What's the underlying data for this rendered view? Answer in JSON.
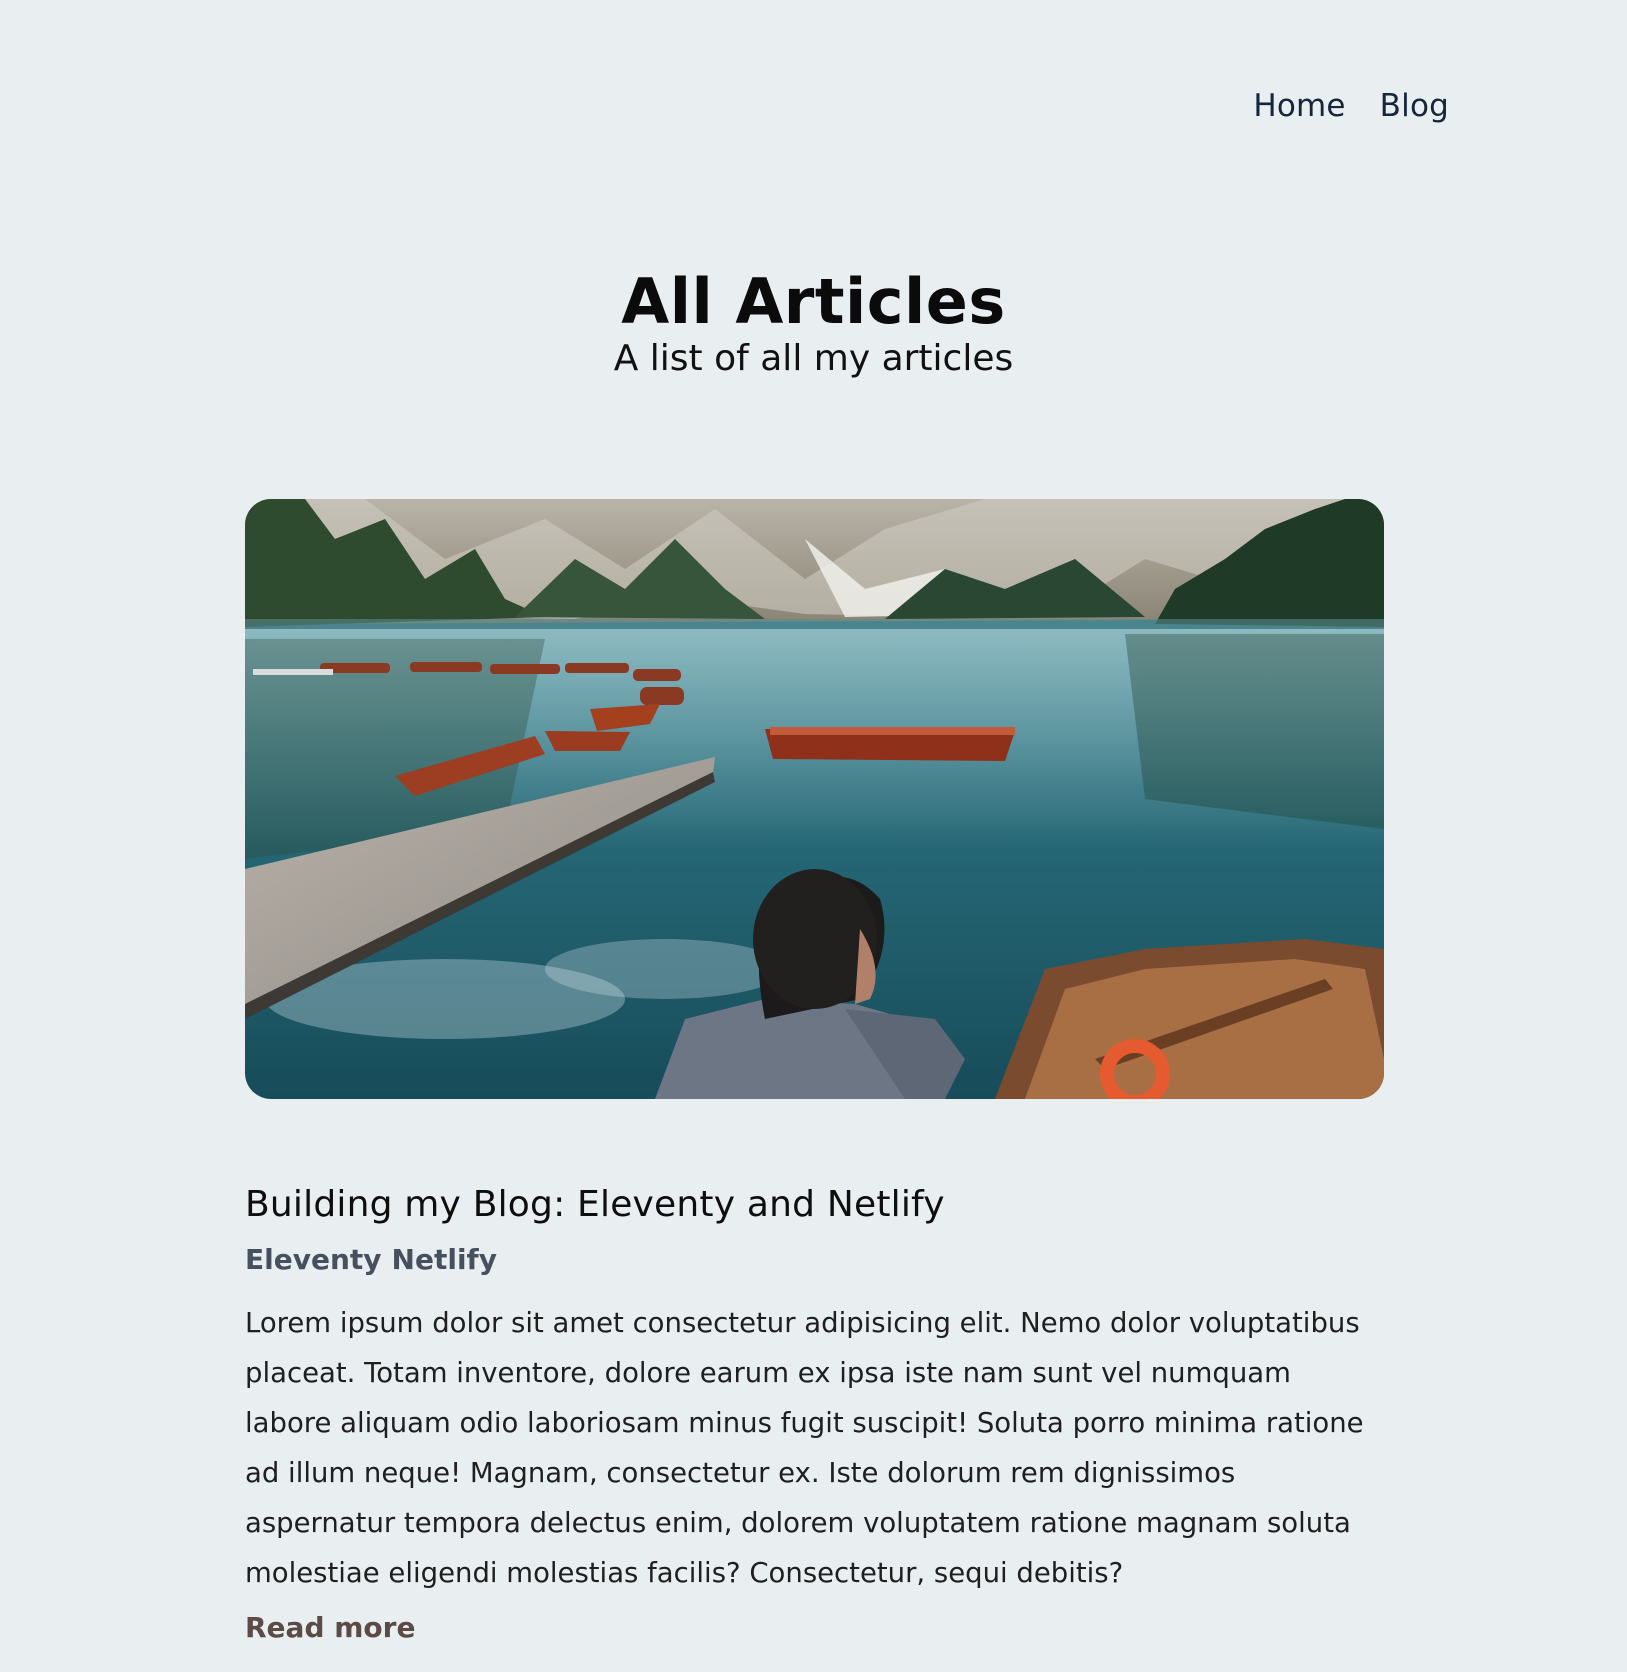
{
  "nav": {
    "items": [
      {
        "label": "Home"
      },
      {
        "label": "Blog"
      }
    ]
  },
  "hero": {
    "title": "All Articles",
    "subtitle": "A list of all my articles"
  },
  "article": {
    "image_description": "",
    "title": "Building my Blog: Eleventy and Netlify",
    "tags": [
      "Eleventy",
      "Netlify"
    ],
    "excerpt": "Lorem ipsum dolor sit amet consectetur adipisicing elit. Nemo dolor voluptatibus placeat. Totam inventore, dolore earum ex ipsa iste nam sunt vel numquam labore aliquam odio laboriosam minus fugit suscipit! Soluta porro minima ratione ad illum neque! Magnam, consectetur ex. Iste dolorum rem dignissimos aspernatur tempora delectus enim, dolorem voluptatem ratione magnam soluta molestiae eligendi molestias facilis? Consectetur, sequi debitis?",
    "read_more_label": "Read more"
  },
  "colors": {
    "background": "#e9eef1",
    "nav_text": "#16263a",
    "tag_text": "#46505e",
    "read_more": "#5b4a45"
  }
}
